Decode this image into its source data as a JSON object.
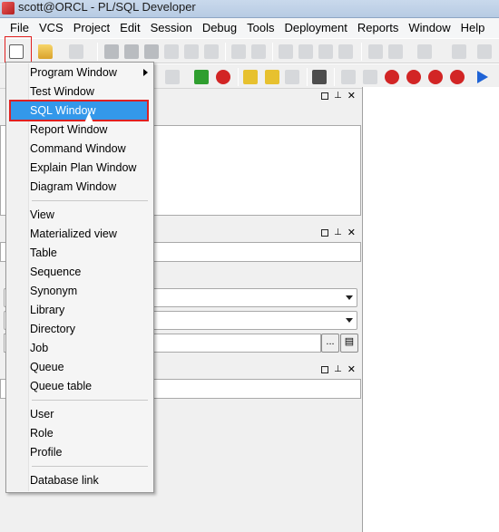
{
  "window": {
    "title": "scott@ORCL - PL/SQL Developer"
  },
  "menubar": {
    "items": [
      "File",
      "VCS",
      "Project",
      "Edit",
      "Session",
      "Debug",
      "Tools",
      "Deployment",
      "Reports",
      "Window",
      "Help"
    ]
  },
  "toolbar": {
    "icons": [
      "new-icon",
      "open-icon",
      "print-icon",
      "save-icon",
      "save-all-icon",
      "undo-icon",
      "redo-icon",
      "cut-icon",
      "copy-icon",
      "paste-icon",
      "find-icon",
      "sql-icon",
      "key-icon",
      "arrow-right-icon"
    ]
  },
  "new_menu": {
    "items": [
      {
        "label": "Program Window",
        "has_submenu": true
      },
      {
        "label": "Test Window"
      },
      {
        "label": "SQL Window",
        "selected": true
      },
      {
        "label": "Report Window"
      },
      {
        "label": "Command Window"
      },
      {
        "label": "Explain Plan Window"
      },
      {
        "label": "Diagram Window"
      }
    ],
    "objects": [
      "View",
      "Materialized view",
      "Table",
      "Sequence",
      "Synonym",
      "Library",
      "Directory",
      "Job",
      "Queue",
      "Queue table"
    ],
    "security": [
      "User",
      "Role",
      "Profile"
    ],
    "links": [
      "Database link"
    ]
  },
  "panels": {
    "controls": [
      "box",
      "pin",
      "close"
    ],
    "browse_button": "..."
  },
  "colors": {
    "selection": "#3398ea",
    "highlight_border": "#e02020"
  }
}
